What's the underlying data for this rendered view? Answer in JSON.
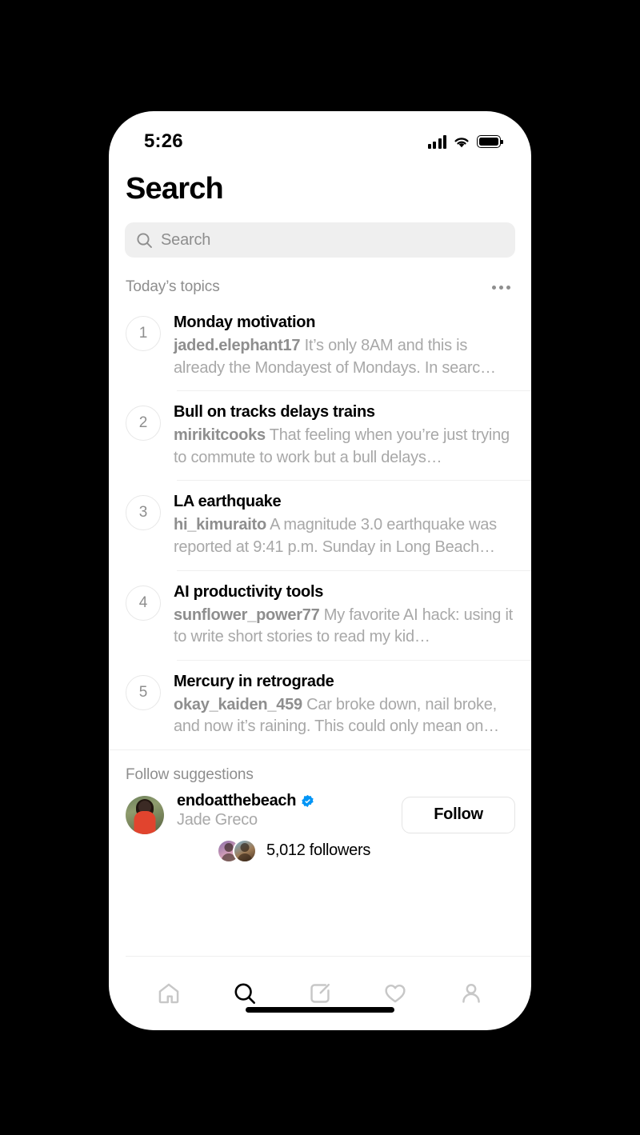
{
  "status_bar": {
    "time": "5:26",
    "signal_icon": "cellular-signal-icon",
    "wifi_icon": "wifi-icon",
    "battery_icon": "battery-full-icon"
  },
  "header": {
    "title": "Search"
  },
  "search": {
    "placeholder": "Search",
    "value": "",
    "icon": "search-icon"
  },
  "topics_section": {
    "title": "Today’s topics",
    "more_icon": "ellipsis-icon",
    "items": [
      {
        "rank": "1",
        "title": "Monday motivation",
        "author": "jaded.elephant17",
        "snippet": "It’s only 8AM and this is already the Mondayest of Mondays. In searc…"
      },
      {
        "rank": "2",
        "title": "Bull on tracks delays trains",
        "author": "mirikitcooks",
        "snippet": "That feeling when you’re just trying to commute to work but a bull delays…"
      },
      {
        "rank": "3",
        "title": "LA earthquake",
        "author": "hi_kimuraito",
        "snippet": "A magnitude 3.0 earthquake was reported at 9:41 p.m. Sunday in Long Beach…"
      },
      {
        "rank": "4",
        "title": "AI productivity tools",
        "author": "sunflower_power77",
        "snippet": "My favorite AI hack: using it to write short stories to read my kid…"
      },
      {
        "rank": "5",
        "title": "Mercury in retrograde",
        "author": "okay_kaiden_459",
        "snippet": "Car broke down, nail broke, and now it’s raining. This could only mean on…"
      }
    ]
  },
  "follow_suggestions": {
    "title": "Follow suggestions",
    "suggestion": {
      "username": "endoatthebeach",
      "verified": true,
      "verified_icon": "verified-badge-icon",
      "full_name": "Jade Greco",
      "followers_text": "5,012 followers",
      "follow_button_label": "Follow",
      "avatar_icon": "user-avatar"
    }
  },
  "tab_bar": {
    "tabs": [
      {
        "name": "home",
        "icon": "home-icon",
        "active": false
      },
      {
        "name": "search",
        "icon": "search-icon",
        "active": true
      },
      {
        "name": "compose",
        "icon": "compose-icon",
        "active": false
      },
      {
        "name": "activity",
        "icon": "heart-icon",
        "active": false
      },
      {
        "name": "profile",
        "icon": "person-icon",
        "active": false
      }
    ]
  },
  "colors": {
    "accent_verified": "#0095f6",
    "text_primary": "#000000",
    "text_secondary": "#8e8e8e",
    "text_tertiary": "#a8a8a8",
    "field_bg": "#efefef",
    "divider": "#efefef"
  }
}
